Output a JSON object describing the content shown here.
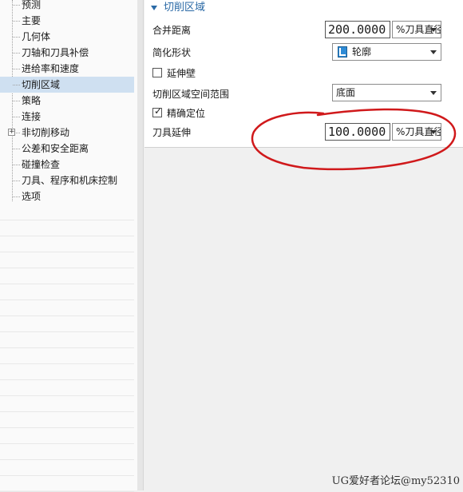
{
  "tree": {
    "items": [
      {
        "label": "预测"
      },
      {
        "label": "主要"
      },
      {
        "label": "几何体"
      },
      {
        "label": "刀轴和刀具补偿"
      },
      {
        "label": "进给率和速度"
      },
      {
        "label": "切削区域",
        "selected": true
      },
      {
        "label": "策略"
      },
      {
        "label": "连接"
      },
      {
        "label": "非切削移动",
        "expandable": true
      },
      {
        "label": "公差和安全距离"
      },
      {
        "label": "碰撞检查"
      },
      {
        "label": "刀具、程序和机床控制"
      },
      {
        "label": "选项"
      }
    ]
  },
  "section": {
    "title": "切削区域",
    "merge_distance": {
      "label": "合并距离",
      "value": "200.0000",
      "unit": "%刀具直径"
    },
    "simplify_shape": {
      "label": "简化形状",
      "value": "轮廓",
      "icon": "contour-icon"
    },
    "extend_wall": {
      "label": "延伸壁",
      "checked": false
    },
    "spatial_range": {
      "label": "切削区域空间范围",
      "value": "底面"
    },
    "precise_position": {
      "label": "精确定位",
      "checked": true,
      "mark": "✓"
    },
    "tool_extension": {
      "label": "刀具延伸",
      "value": "100.0000",
      "unit": "%刀具直径"
    }
  },
  "colors": {
    "accent": "#2b6aa6",
    "annotation": "#d0191b",
    "selected": "#cfe0f1"
  },
  "watermark": "UG爱好者论坛@my52310"
}
